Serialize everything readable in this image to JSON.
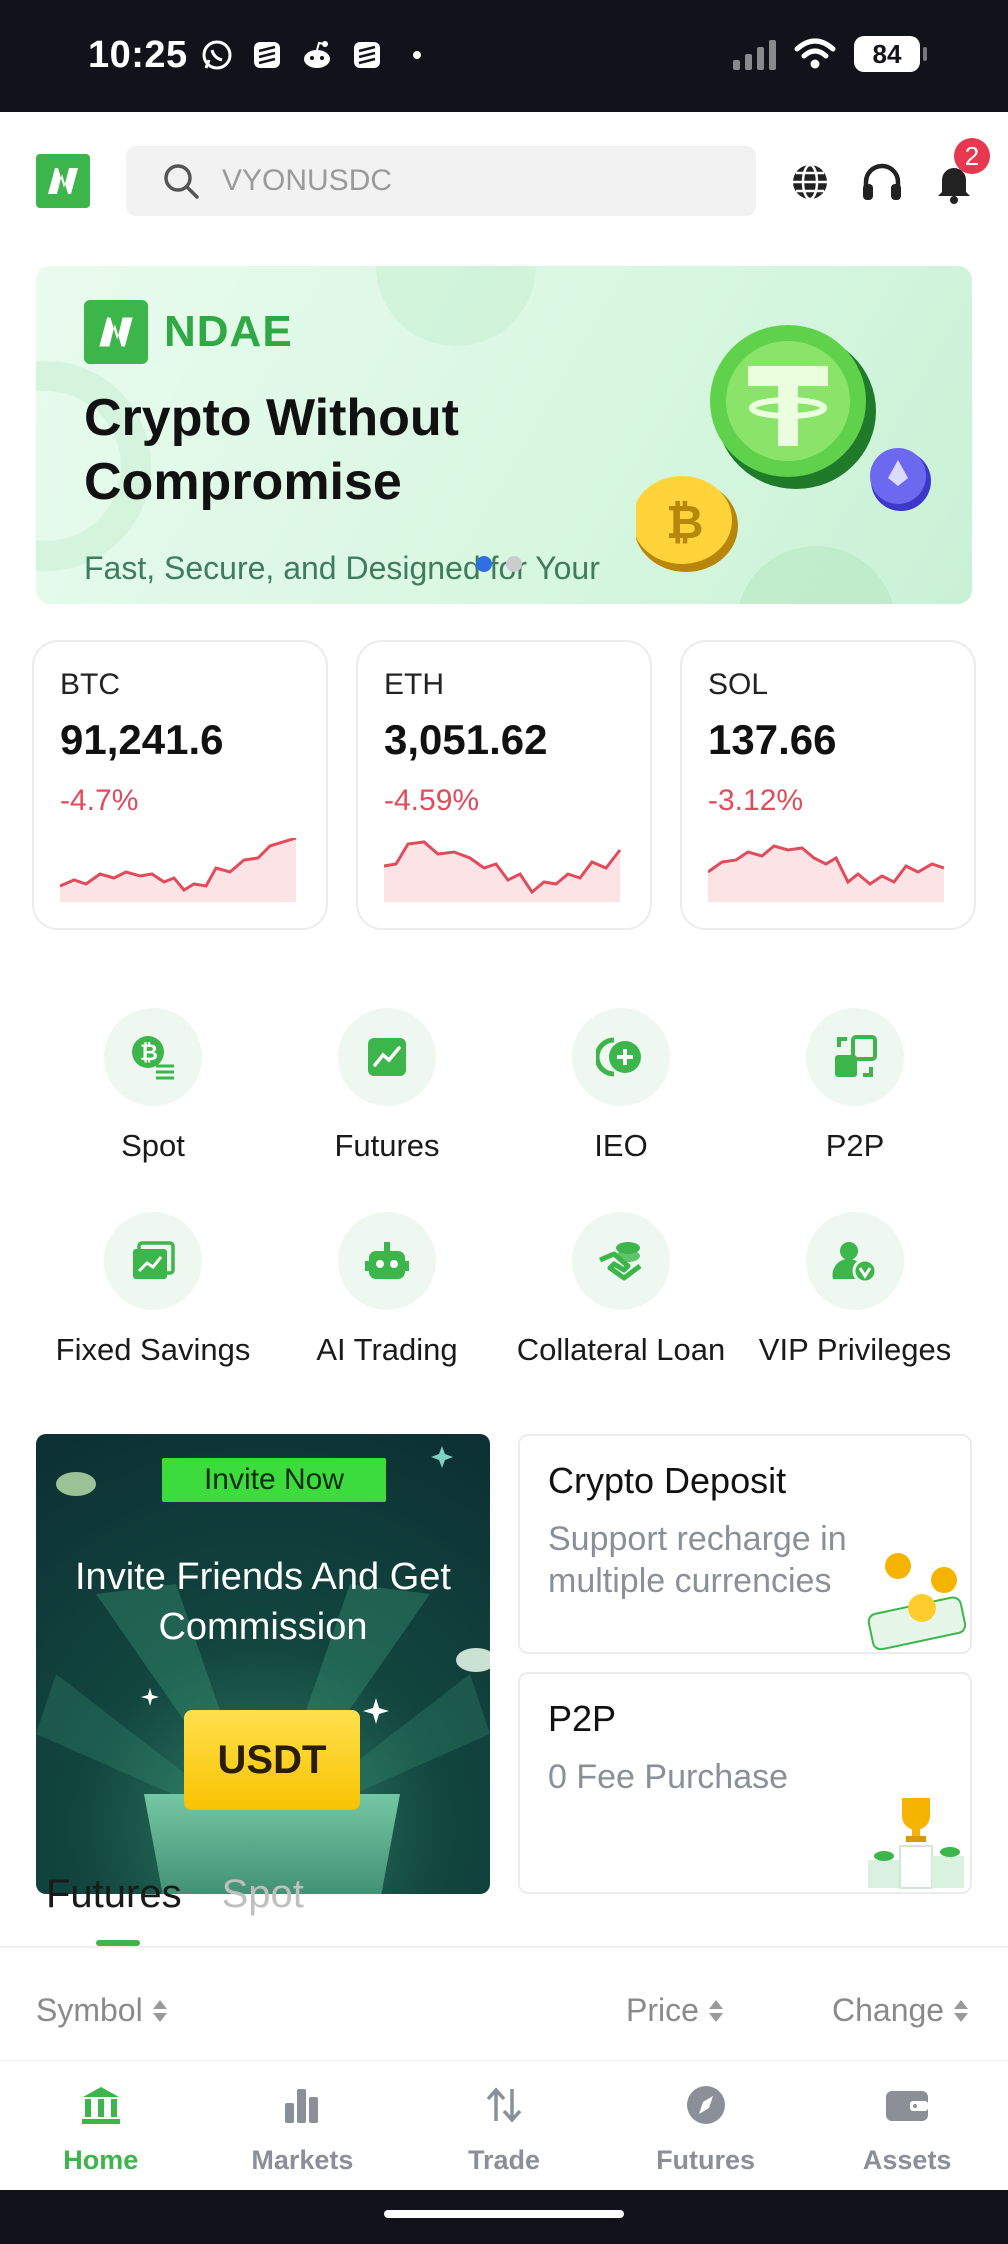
{
  "status_bar": {
    "time": "10:25",
    "battery": "84"
  },
  "header": {
    "search_placeholder": "VYONUSDC",
    "notification_count": "2"
  },
  "banner": {
    "brand": "NDAE",
    "headline": "Crypto Without Compromise",
    "subtitle": "Fast, Secure, and Designed for Your Financial Success"
  },
  "tickers": [
    {
      "symbol": "BTC",
      "price": "91,241.6",
      "change": "-4.7%"
    },
    {
      "symbol": "ETH",
      "price": "3,051.62",
      "change": "-4.59%"
    },
    {
      "symbol": "SOL",
      "price": "137.66",
      "change": "-3.12%"
    }
  ],
  "services": [
    {
      "label": "Spot",
      "icon": "bitcoin-exchange-icon"
    },
    {
      "label": "Futures",
      "icon": "trend-chart-icon"
    },
    {
      "label": "IEO",
      "icon": "plus-coin-icon"
    },
    {
      "label": "P2P",
      "icon": "p2p-swap-icon"
    },
    {
      "label": "Fixed Savings",
      "icon": "savings-chart-icon"
    },
    {
      "label": "AI Trading",
      "icon": "robot-icon"
    },
    {
      "label": "Collateral Loan",
      "icon": "hand-coin-icon"
    },
    {
      "label": "VIP Privileges",
      "icon": "vip-user-icon"
    }
  ],
  "invite": {
    "button": "Invite Now",
    "title": "Invite Friends And Get Commission",
    "token": "USDT"
  },
  "promo_cards": [
    {
      "title": "Crypto Deposit",
      "subtitle": "Support recharge in multiple currencies"
    },
    {
      "title": "P2P",
      "subtitle": "0 Fee Purchase"
    }
  ],
  "market_tabs": [
    "Futures",
    "Spot"
  ],
  "table_headers": {
    "symbol": "Symbol",
    "price": "Price",
    "change": "Change"
  },
  "bottom_nav": [
    "Home",
    "Markets",
    "Trade",
    "Futures",
    "Assets"
  ],
  "colors": {
    "brand_green": "#3cb54a",
    "negative_red": "#e14b5a",
    "badge_red": "#e8384f"
  }
}
